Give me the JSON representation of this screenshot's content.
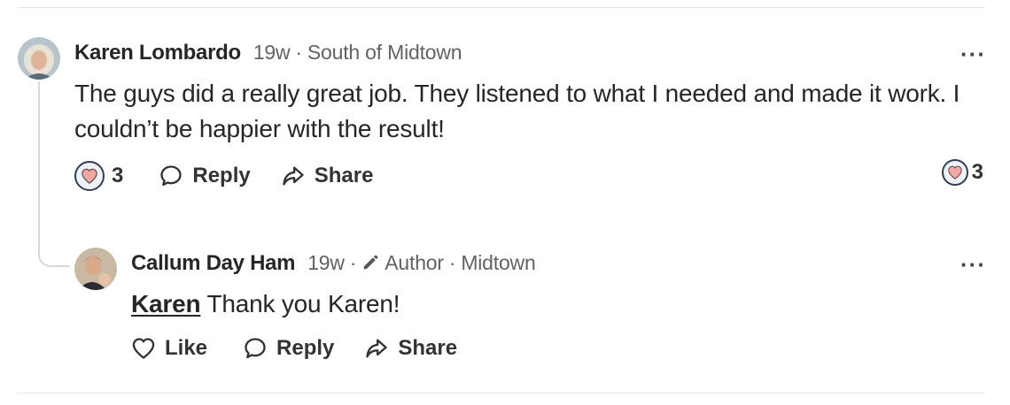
{
  "comments": [
    {
      "author": "Karen Lombardo",
      "time": "19w",
      "separator": "·",
      "location": "South of Midtown",
      "text": "The guys did a really great job. They listened to what I needed and made it work. I couldn’t be happier with the result!",
      "reaction_count": "3",
      "reply_label": "Reply",
      "share_label": "Share",
      "side_reaction_count": "3",
      "more_label": "···"
    },
    {
      "author": "Callum Day Ham",
      "time": "19w",
      "separator": "·",
      "role": "Author",
      "location": "Midtown",
      "mention": "Karen",
      "text": " Thank you Karen!",
      "like_label": "Like",
      "reply_label": "Reply",
      "share_label": "Share",
      "more_label": "···"
    }
  ],
  "colors": {
    "heart_fill": "#f4a6a0",
    "badge_border": "#2f3e5a",
    "meta_text": "#5f6368"
  }
}
